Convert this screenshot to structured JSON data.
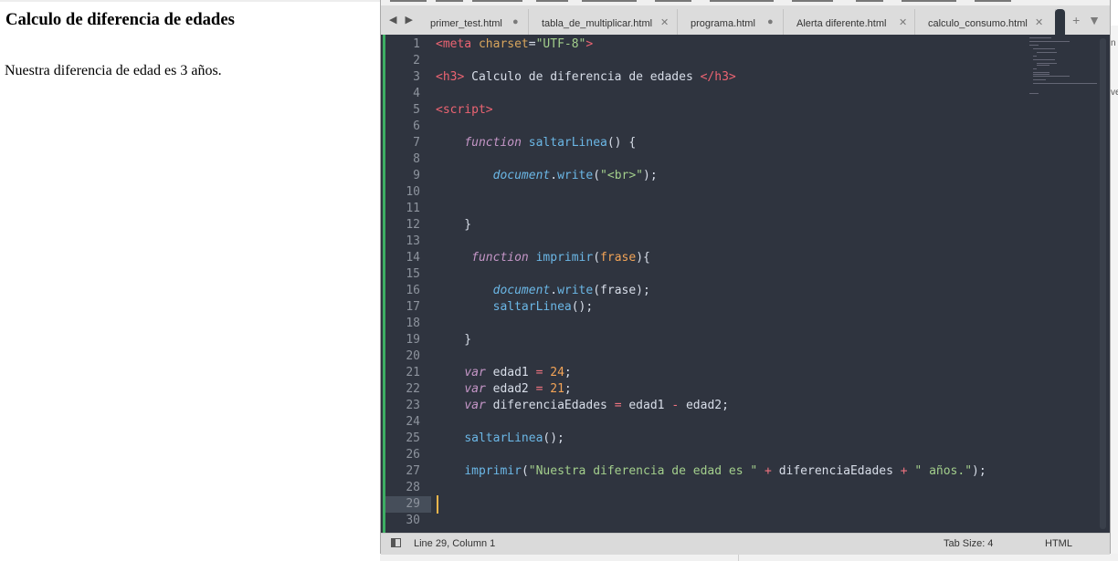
{
  "browser": {
    "heading": "Calculo de diferencia de edades",
    "output_text": "Nuestra diferencia de edad es 3 años."
  },
  "background_window": {
    "letters": [
      "n",
      "ve"
    ]
  },
  "editor": {
    "nav_arrows": "◀ ▶",
    "tabs": [
      {
        "label": "primer_test.html",
        "mark": "●"
      },
      {
        "label": "tabla_de_multiplicar.html",
        "mark": "✕"
      },
      {
        "label": "programa.html",
        "mark": "●"
      },
      {
        "label": "Alerta diferente.html",
        "mark": "✕"
      },
      {
        "label": "calculo_consumo.html",
        "mark": "✕"
      },
      {
        "label": "",
        "mark": ""
      }
    ],
    "tab_actions": {
      "new_tab": "+",
      "menu": "▼"
    },
    "current_line": 29,
    "lines": [
      {
        "n": "1",
        "tokens": [
          [
            "t-tag",
            "<meta"
          ],
          [
            "t-plain",
            " "
          ],
          [
            "t-attr",
            "charset"
          ],
          [
            "t-plain",
            "="
          ],
          [
            "t-str",
            "\"UTF-8\""
          ],
          [
            "t-tag",
            ">"
          ]
        ]
      },
      {
        "n": "2",
        "tokens": []
      },
      {
        "n": "3",
        "tokens": [
          [
            "t-tag",
            "<h3>"
          ],
          [
            "t-plain",
            " Calculo de diferencia de edades "
          ],
          [
            "t-tag",
            "</h3>"
          ]
        ]
      },
      {
        "n": "4",
        "tokens": []
      },
      {
        "n": "5",
        "tokens": [
          [
            "t-tag",
            "<script>"
          ]
        ]
      },
      {
        "n": "6",
        "tokens": []
      },
      {
        "n": "7",
        "tokens": [
          [
            "t-plain",
            "    "
          ],
          [
            "t-kw",
            "function"
          ],
          [
            "t-plain",
            " "
          ],
          [
            "t-fn",
            "saltarLinea"
          ],
          [
            "t-plain",
            "() {"
          ]
        ]
      },
      {
        "n": "8",
        "tokens": []
      },
      {
        "n": "9",
        "tokens": [
          [
            "t-plain",
            "        "
          ],
          [
            "t-obj",
            "document"
          ],
          [
            "t-plain",
            "."
          ],
          [
            "t-fn",
            "write"
          ],
          [
            "t-plain",
            "("
          ],
          [
            "t-str",
            "\"<br>\""
          ],
          [
            "t-plain",
            ");"
          ]
        ]
      },
      {
        "n": "10",
        "tokens": []
      },
      {
        "n": "11",
        "tokens": []
      },
      {
        "n": "12",
        "tokens": [
          [
            "t-plain",
            "    }"
          ]
        ]
      },
      {
        "n": "13",
        "tokens": []
      },
      {
        "n": "14",
        "tokens": [
          [
            "t-plain",
            "     "
          ],
          [
            "t-kw",
            "function"
          ],
          [
            "t-plain",
            " "
          ],
          [
            "t-fn",
            "imprimir"
          ],
          [
            "t-plain",
            "("
          ],
          [
            "t-param",
            "frase"
          ],
          [
            "t-plain",
            "){"
          ]
        ]
      },
      {
        "n": "15",
        "tokens": []
      },
      {
        "n": "16",
        "tokens": [
          [
            "t-plain",
            "        "
          ],
          [
            "t-obj",
            "document"
          ],
          [
            "t-plain",
            "."
          ],
          [
            "t-fn",
            "write"
          ],
          [
            "t-plain",
            "(frase);"
          ]
        ]
      },
      {
        "n": "17",
        "tokens": [
          [
            "t-plain",
            "        "
          ],
          [
            "t-fn",
            "saltarLinea"
          ],
          [
            "t-plain",
            "();"
          ]
        ]
      },
      {
        "n": "18",
        "tokens": []
      },
      {
        "n": "19",
        "tokens": [
          [
            "t-plain",
            "    }"
          ]
        ]
      },
      {
        "n": "20",
        "tokens": []
      },
      {
        "n": "21",
        "tokens": [
          [
            "t-plain",
            "    "
          ],
          [
            "t-kw",
            "var"
          ],
          [
            "t-plain",
            " edad1 "
          ],
          [
            "t-op",
            "="
          ],
          [
            "t-plain",
            " "
          ],
          [
            "t-num",
            "24"
          ],
          [
            "t-plain",
            ";"
          ]
        ]
      },
      {
        "n": "22",
        "tokens": [
          [
            "t-plain",
            "    "
          ],
          [
            "t-kw",
            "var"
          ],
          [
            "t-plain",
            " edad2 "
          ],
          [
            "t-op",
            "="
          ],
          [
            "t-plain",
            " "
          ],
          [
            "t-num",
            "21"
          ],
          [
            "t-plain",
            ";"
          ]
        ]
      },
      {
        "n": "23",
        "tokens": [
          [
            "t-plain",
            "    "
          ],
          [
            "t-kw",
            "var"
          ],
          [
            "t-plain",
            " diferenciaEdades "
          ],
          [
            "t-op",
            "="
          ],
          [
            "t-plain",
            " edad1 "
          ],
          [
            "t-op",
            "-"
          ],
          [
            "t-plain",
            " edad2;"
          ]
        ]
      },
      {
        "n": "24",
        "tokens": []
      },
      {
        "n": "25",
        "tokens": [
          [
            "t-plain",
            "    "
          ],
          [
            "t-fn",
            "saltarLinea"
          ],
          [
            "t-plain",
            "();"
          ]
        ]
      },
      {
        "n": "26",
        "tokens": []
      },
      {
        "n": "27",
        "tokens": [
          [
            "t-plain",
            "    "
          ],
          [
            "t-fn",
            "imprimir"
          ],
          [
            "t-plain",
            "("
          ],
          [
            "t-str",
            "\"Nuestra diferencia de edad es \""
          ],
          [
            "t-plain",
            " "
          ],
          [
            "t-op",
            "+"
          ],
          [
            "t-plain",
            " diferenciaEdades "
          ],
          [
            "t-op",
            "+"
          ],
          [
            "t-plain",
            " "
          ],
          [
            "t-str",
            "\" años.\""
          ],
          [
            "t-plain",
            ");"
          ]
        ]
      },
      {
        "n": "28",
        "tokens": []
      },
      {
        "n": "29",
        "tokens": []
      },
      {
        "n": "30",
        "tokens": []
      }
    ]
  },
  "status_bar": {
    "position": "Line 29, Column 1",
    "tab_size": "Tab Size: 4",
    "syntax": "HTML"
  },
  "colors": {
    "editor_bg": "#2f343f",
    "accent_green": "#3dae63",
    "caret": "#f0b64b",
    "tag": "#ec6472",
    "string": "#a3cf8c"
  }
}
